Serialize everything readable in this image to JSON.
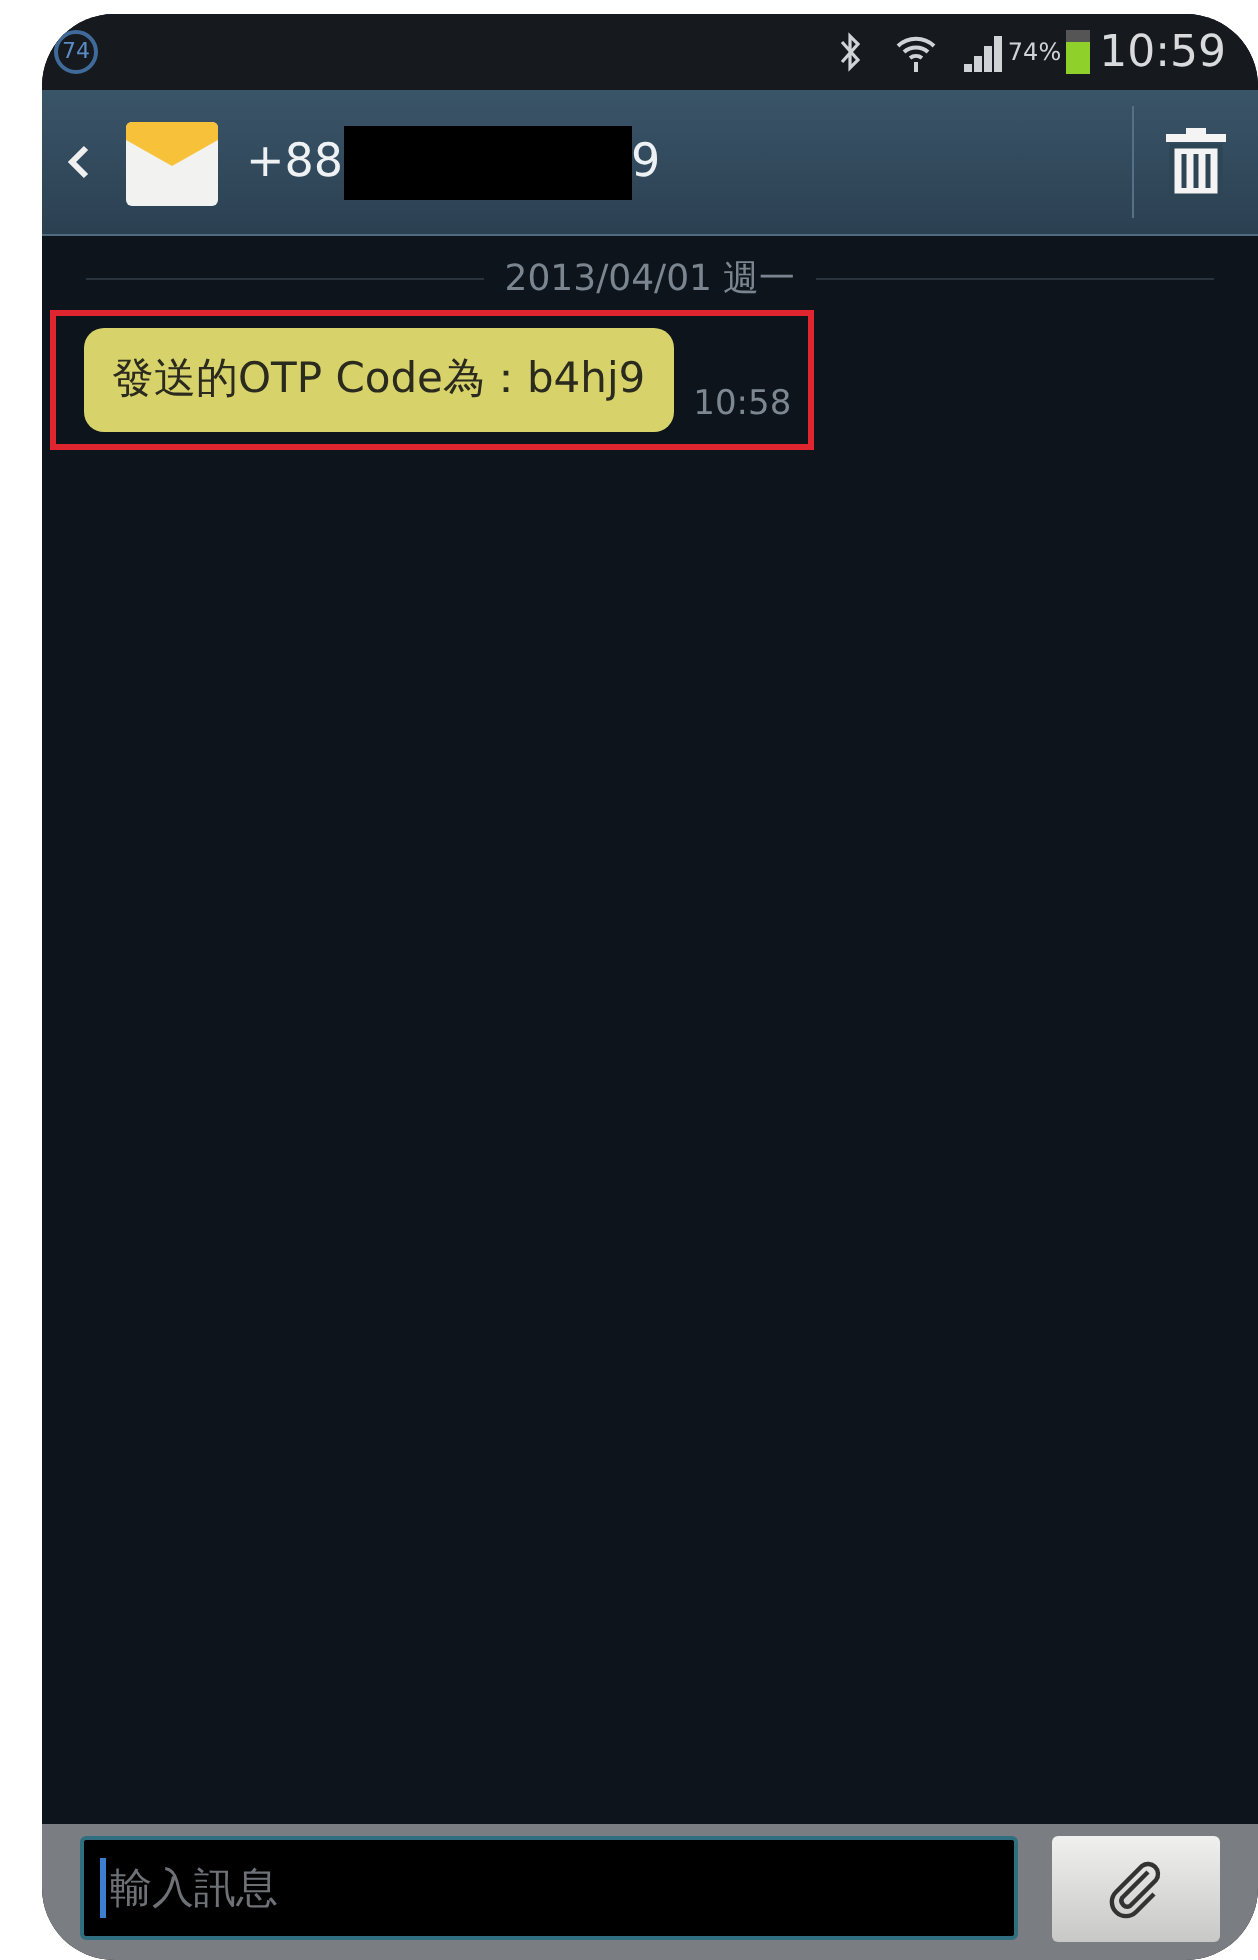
{
  "status_bar": {
    "notification_badge": "74",
    "battery_percent": "74%",
    "time": "10:59"
  },
  "header": {
    "number_start": "+88",
    "redacted": true,
    "number_end": "9"
  },
  "date_divider": "2013/04/01 週一",
  "messages": [
    {
      "text": "發送的OTP Code為：b4hj9",
      "time": "10:58",
      "highlighted": true
    }
  ],
  "composer": {
    "placeholder": "輸入訊息"
  }
}
